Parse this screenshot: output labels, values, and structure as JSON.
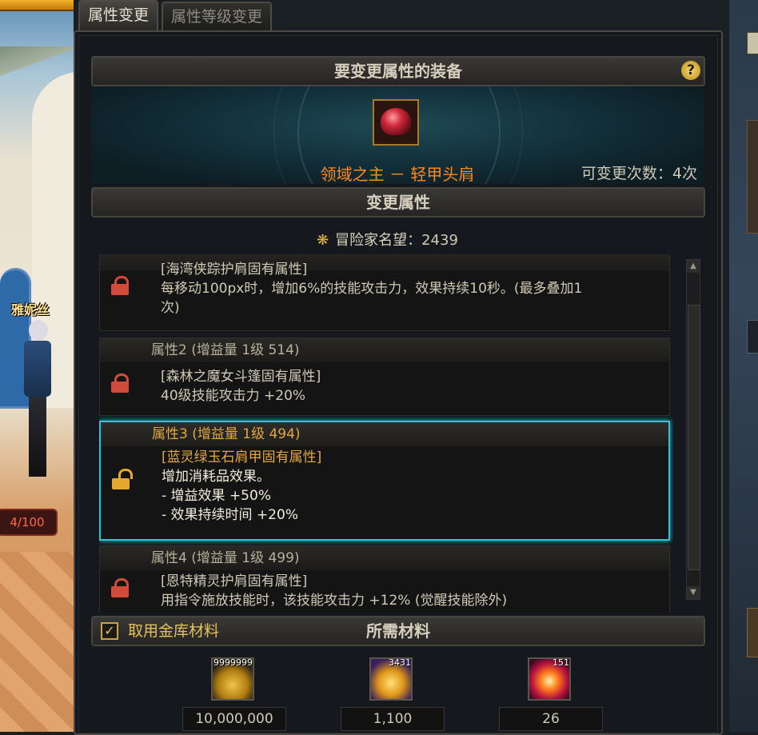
{
  "tabs": [
    "属性变更",
    "属性等级变更"
  ],
  "scene": {
    "character_name": "雅妮丝",
    "hp_text": "4/100"
  },
  "equip_section": {
    "title": "要变更属性的装备",
    "help": "?",
    "item_name": "领域之主 － 轻甲头肩",
    "change_count": "可变更次数：4次"
  },
  "change_section": {
    "title": "变更属性",
    "fame_label": "冒险家名望",
    "fame_value": "：2439"
  },
  "properties": [
    {
      "title": "",
      "locked": true,
      "source": "[海湾侠踪护肩固有属性]",
      "lines": [
        "每移动100px时，增加6%的技能攻击力，效果持续10秒。(最多叠加1",
        "次)"
      ]
    },
    {
      "title": "属性2 (增益量 1级 514)",
      "locked": true,
      "source": "[森林之魔女斗篷固有属性]",
      "lines": [
        "40级技能攻击力 +20%"
      ]
    },
    {
      "title": "属性3 (增益量 1级 494)",
      "locked": false,
      "selected": true,
      "source": "[蓝灵绿玉石肩甲固有属性]",
      "lines": [
        "增加消耗品效果。",
        "- 增益效果 +50%",
        "- 效果持续时间 +20%"
      ]
    },
    {
      "title": "属性4 (增益量 1级 499)",
      "locked": true,
      "source": "[恩特精灵护肩固有属性]",
      "lines": [
        "用指令施放技能时，该技能攻击力 +12% (觉醒技能除外)"
      ]
    }
  ],
  "materials_section": {
    "checkbox_label": "取用金库材料",
    "checked": true,
    "title": "所需材料",
    "items": [
      {
        "icon": "gold-coins-icon",
        "count": "9999999",
        "value": "10,000,000"
      },
      {
        "icon": "golden-crystal-icon",
        "count": "3431",
        "value": "1,100"
      },
      {
        "icon": "fire-orb-icon",
        "count": "151",
        "value": "26"
      }
    ]
  },
  "colors": {
    "accent_orange": "#ff8a1d",
    "selected_border": "#28c6d8",
    "lock_red": "#d24a3a",
    "lock_gold": "#e5a82c"
  }
}
